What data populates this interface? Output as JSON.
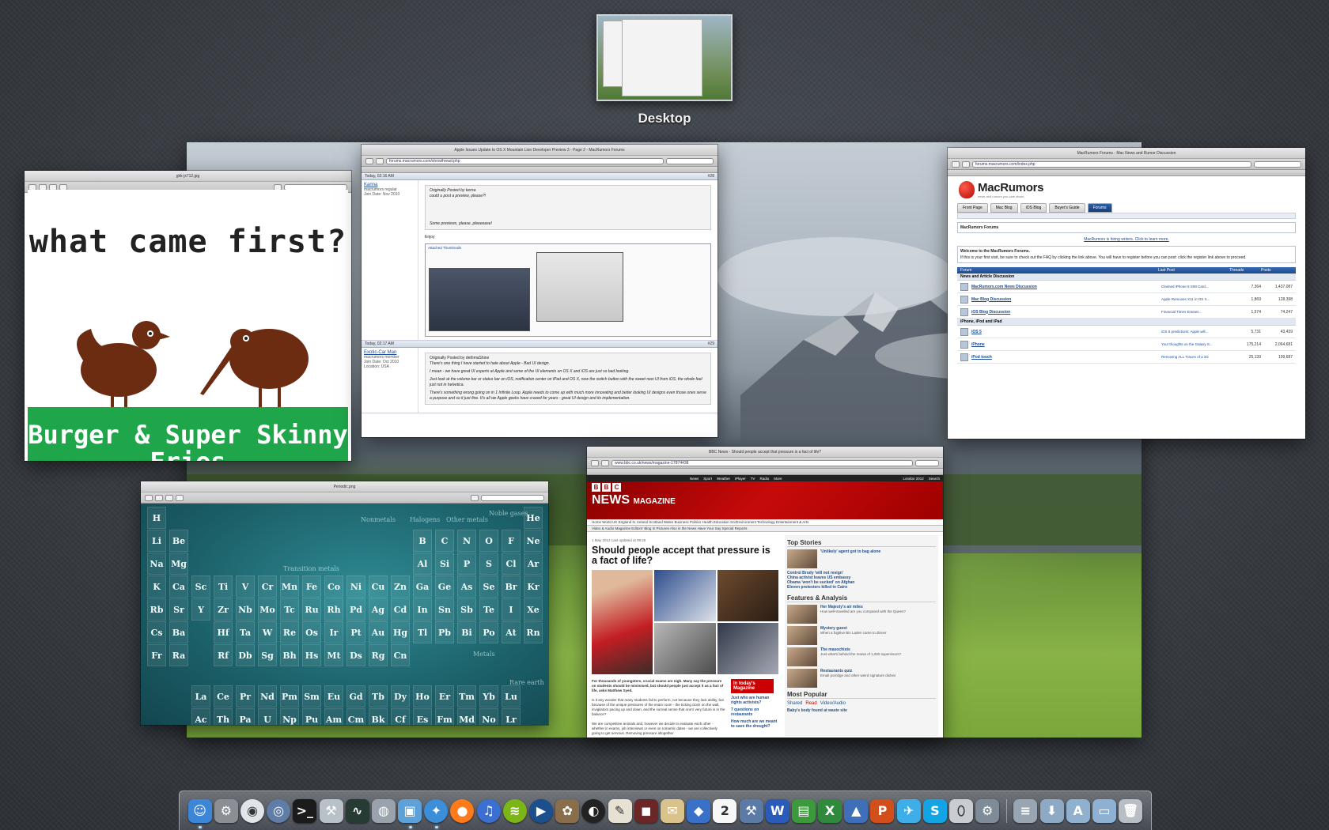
{
  "spaces": {
    "desktop_label": "Desktop"
  },
  "preview1": {
    "title": "gkk-jx712.jpg",
    "poster_title": "what came first?",
    "poster_band": "Burger & Super Skinny Fries"
  },
  "forum": {
    "title": "Apple Issues Update to OS X Mountain Lion Developer Preview 3 - Page 2 - MacRumors Forums",
    "url": "forums.macrumors.com/showthread.php",
    "post1": {
      "time": "Today, 02:16 AM",
      "num": "#28",
      "user": "Karina",
      "role": "macrumors regular",
      "join": "Join Date: Nov 2010",
      "quote_by": "Originally Posted by kerna",
      "quote_text": "could u post a preview, please?!",
      "quote_line2": "Some previews, please, pleeeease!",
      "enjoy": "Enjoy",
      "thumbs": "Attached Thumbnails"
    },
    "post2": {
      "time": "Today, 02:17 AM",
      "num": "#29",
      "user": "Exotic-Car Man",
      "role": "macrumors member",
      "join": "Join Date: Oct 2010",
      "location": "Location: USA",
      "quote_by": "Originally Posted by dethmaShine",
      "quote_text": "There's one thing I have started to hate about Apple - Bad UI design.",
      "line1": "I mean - we have great UI experts at Apple and some of the UI elements on OS X and iOS are just so bad looking.",
      "line2": "Just look at the volume bar or status bar on iOS, notification center on iPad and OS X, now the switch button with the sweet new UI from iOS, the whole feel just not in helvetica.",
      "line3": "There's something wrong going on in 1 Infinite Loop. Apple needs to come up with much more innovating and better looking UI designs even those ones serve a purpose and so it just fine. It's all we Apple geeks have craved for years - great UI design and its implementation."
    }
  },
  "macrumors": {
    "title": "MacRumors Forums - Mac News and Rumor Discussion",
    "url": "forums.macrumors.com/index.php",
    "logo": "MacRumors",
    "tagline": "news and rumors you care about",
    "nav": [
      "Front Page",
      "Mac Blog",
      "iOS Blog",
      "Buyer's Guide",
      "Forums"
    ],
    "forum_title": "MacRumors Forums",
    "link": "MacRumors is hiring writers. Click to learn more.",
    "welcome": "Welcome to the MacRumors Forums.",
    "welcome_text": "If this is your first visit, be sure to check out the FAQ by clicking the link above. You will have to register before you can post: click the register link above to proceed.",
    "col_forum": "Forum",
    "col_last": "Last Post",
    "col_threads": "Threads",
    "col_posts": "Posts",
    "cat1": "News and Article Discussion",
    "cat2": "iPhone, iPod and iPad",
    "rows": [
      {
        "name": "MacRumors.com News Discussion",
        "last": "Claimed iPhone 5 SIM Card...",
        "threads": "7,364",
        "posts": "1,437,087"
      },
      {
        "name": "Mac Blog Discussion",
        "last": "Apple Removes X11 in OS X...",
        "threads": "1,869",
        "posts": "128,398"
      },
      {
        "name": "iOS Blog Discussion",
        "last": "Financial Times Eraises...",
        "threads": "1,574",
        "posts": "74,247"
      },
      {
        "name": "iOS 5",
        "last": "iOS 5 predictions: Apple will...",
        "threads": "5,731",
        "posts": "43,439"
      },
      {
        "name": "iPhone",
        "last": "Your thoughts on the Galaxy S...",
        "threads": "175,214",
        "posts": "2,064,681"
      },
      {
        "name": "iPod touch",
        "last": "Removing ALL Traces of a 3G",
        "threads": "25,139",
        "posts": "199,687"
      }
    ]
  },
  "periodic": {
    "title": "Periodic.png",
    "nonmetals": "Nonmetals",
    "halogens": "Halogens",
    "noble": "Noble gases",
    "other_metals": "Other metals",
    "transition": "Transition metals",
    "metals": "Metals",
    "rare_earth": "Rare earth",
    "elements": [
      [
        "H",
        1,
        1
      ],
      [
        "He",
        1,
        18
      ],
      [
        "Li",
        2,
        1
      ],
      [
        "Be",
        2,
        2
      ],
      [
        "B",
        2,
        13
      ],
      [
        "C",
        2,
        14
      ],
      [
        "N",
        2,
        15
      ],
      [
        "O",
        2,
        16
      ],
      [
        "F",
        2,
        17
      ],
      [
        "Ne",
        2,
        18
      ],
      [
        "Na",
        3,
        1
      ],
      [
        "Mg",
        3,
        2
      ],
      [
        "Al",
        3,
        13
      ],
      [
        "Si",
        3,
        14
      ],
      [
        "P",
        3,
        15
      ],
      [
        "S",
        3,
        16
      ],
      [
        "Cl",
        3,
        17
      ],
      [
        "Ar",
        3,
        18
      ],
      [
        "K",
        4,
        1
      ],
      [
        "Ca",
        4,
        2
      ],
      [
        "Sc",
        4,
        3
      ],
      [
        "Ti",
        4,
        4
      ],
      [
        "V",
        4,
        5
      ],
      [
        "Cr",
        4,
        6
      ],
      [
        "Mn",
        4,
        7
      ],
      [
        "Fe",
        4,
        8
      ],
      [
        "Co",
        4,
        9
      ],
      [
        "Ni",
        4,
        10
      ],
      [
        "Cu",
        4,
        11
      ],
      [
        "Zn",
        4,
        12
      ],
      [
        "Ga",
        4,
        13
      ],
      [
        "Ge",
        4,
        14
      ],
      [
        "As",
        4,
        15
      ],
      [
        "Se",
        4,
        16
      ],
      [
        "Br",
        4,
        17
      ],
      [
        "Kr",
        4,
        18
      ],
      [
        "Rb",
        5,
        1
      ],
      [
        "Sr",
        5,
        2
      ],
      [
        "Y",
        5,
        3
      ],
      [
        "Zr",
        5,
        4
      ],
      [
        "Nb",
        5,
        5
      ],
      [
        "Mo",
        5,
        6
      ],
      [
        "Tc",
        5,
        7
      ],
      [
        "Ru",
        5,
        8
      ],
      [
        "Rh",
        5,
        9
      ],
      [
        "Pd",
        5,
        10
      ],
      [
        "Ag",
        5,
        11
      ],
      [
        "Cd",
        5,
        12
      ],
      [
        "In",
        5,
        13
      ],
      [
        "Sn",
        5,
        14
      ],
      [
        "Sb",
        5,
        15
      ],
      [
        "Te",
        5,
        16
      ],
      [
        "I",
        5,
        17
      ],
      [
        "Xe",
        5,
        18
      ],
      [
        "Cs",
        6,
        1
      ],
      [
        "Ba",
        6,
        2
      ],
      [
        "Hf",
        6,
        4
      ],
      [
        "Ta",
        6,
        5
      ],
      [
        "W",
        6,
        6
      ],
      [
        "Re",
        6,
        7
      ],
      [
        "Os",
        6,
        8
      ],
      [
        "Ir",
        6,
        9
      ],
      [
        "Pt",
        6,
        10
      ],
      [
        "Au",
        6,
        11
      ],
      [
        "Hg",
        6,
        12
      ],
      [
        "Tl",
        6,
        13
      ],
      [
        "Pb",
        6,
        14
      ],
      [
        "Bi",
        6,
        15
      ],
      [
        "Po",
        6,
        16
      ],
      [
        "At",
        6,
        17
      ],
      [
        "Rn",
        6,
        18
      ],
      [
        "Fr",
        7,
        1
      ],
      [
        "Ra",
        7,
        2
      ],
      [
        "Rf",
        7,
        4
      ],
      [
        "Db",
        7,
        5
      ],
      [
        "Sg",
        7,
        6
      ],
      [
        "Bh",
        7,
        7
      ],
      [
        "Hs",
        7,
        8
      ],
      [
        "Mt",
        7,
        9
      ],
      [
        "Ds",
        7,
        10
      ],
      [
        "Rg",
        7,
        11
      ],
      [
        "Cn",
        7,
        12
      ],
      [
        "La",
        9,
        3
      ],
      [
        "Ce",
        9,
        4
      ],
      [
        "Pr",
        9,
        5
      ],
      [
        "Nd",
        9,
        6
      ],
      [
        "Pm",
        9,
        7
      ],
      [
        "Sm",
        9,
        8
      ],
      [
        "Eu",
        9,
        9
      ],
      [
        "Gd",
        9,
        10
      ],
      [
        "Tb",
        9,
        11
      ],
      [
        "Dy",
        9,
        12
      ],
      [
        "Ho",
        9,
        13
      ],
      [
        "Er",
        9,
        14
      ],
      [
        "Tm",
        9,
        15
      ],
      [
        "Yb",
        9,
        16
      ],
      [
        "Lu",
        9,
        17
      ],
      [
        "Ac",
        10,
        3
      ],
      [
        "Th",
        10,
        4
      ],
      [
        "Pa",
        10,
        5
      ],
      [
        "U",
        10,
        6
      ],
      [
        "Np",
        10,
        7
      ],
      [
        "Pu",
        10,
        8
      ],
      [
        "Am",
        10,
        9
      ],
      [
        "Cm",
        10,
        10
      ],
      [
        "Bk",
        10,
        11
      ],
      [
        "Cf",
        10,
        12
      ],
      [
        "Es",
        10,
        13
      ],
      [
        "Fm",
        10,
        14
      ],
      [
        "Md",
        10,
        15
      ],
      [
        "No",
        10,
        16
      ],
      [
        "Lr",
        10,
        17
      ]
    ]
  },
  "bbc": {
    "title": "BBC News - Should people accept that pressure is a fact of life?",
    "url": "www.bbc.co.uk/news/magazine-17874438",
    "topbar": [
      "News",
      "Sport",
      "Weather",
      "iPlayer",
      "TV",
      "Radio",
      "More"
    ],
    "search": "Search",
    "london": "London 2012",
    "magazine": "NEWS",
    "magazine_sub": "MAGAZINE",
    "nav": "Home  World  UK  England  N. Ireland  Scotland  Wales  Business  Politics  Health  Education  Sci/Environment  Technology  Entertainment & Arts",
    "subnav": "Video & Audio  Magazine  Editors' Blog  In Pictures  Also in the News  Have Your Say  Special Reports",
    "date": "1 May 2012 Last updated at 09:25",
    "headline": "Should people accept that pressure is a fact of life?",
    "lede": "For thousands of youngsters, crucial exams are nigh. Many say the pressure on students should be minimised, but should people just accept it as a fact of life, asks Matthew Syed.",
    "body": "Is it any wonder that many students fail to perform, not because they lack ability, but because of the unique pressures of the exam room - the ticking clock on the wall, invigilators pacing up and down, and the surreal sense that one's very future is in the balance?",
    "body2": "We are competitive animals and, however we decide to evaluate each other - whether in exams, job interviews or even on romantic dates - we are collectively going to get nervous. Removing pressure altogether",
    "todays_mag": "In today's Magazine",
    "mag_links": [
      "Just who are human rights activists?",
      "7 questions on restaurants",
      "How much are we meant to save the drought?"
    ],
    "top_stories": "Top Stories",
    "top_items": [
      "'Unlikely' agent got to bag alone",
      "Control Brody 'will not resign'",
      "China activist leaves US embassy",
      "Obama 'won't be sucked' on Afghan",
      "Eleven protesters killed in Cairo"
    ],
    "features": "Features & Analysis",
    "feature_items": [
      {
        "title": "Her Majesty's air miles",
        "sub": "How well-travelled are you compared with the Queen?"
      },
      {
        "title": "Mystery guest",
        "sub": "When a fugitive Bin Laden came to dinner"
      },
      {
        "title": "The masochists",
        "sub": "Just what's behind the mania of 1,000 supervisors?"
      },
      {
        "title": "Restaurants quiz",
        "sub": "Email porridge and other weird signature dishes"
      }
    ],
    "most_popular": "Most Popular",
    "tabs": [
      "Shared",
      "Read",
      "Video/Audio"
    ],
    "popular_item": "Baby's body found at waste site"
  },
  "dock": {
    "items": [
      {
        "name": "finder",
        "glyph": "☺",
        "bg": "#3c86d8",
        "running": true
      },
      {
        "name": "system-preferences",
        "glyph": "⚙",
        "bg": "#8a8f96",
        "running": false
      },
      {
        "name": "airport-utility",
        "glyph": "◉",
        "bg": "#dfe5ea",
        "running": false
      },
      {
        "name": "network-utility",
        "glyph": "◎",
        "bg": "#5f7da6",
        "running": false
      },
      {
        "name": "terminal",
        "glyph": ">_",
        "bg": "#1b1b1b",
        "running": false
      },
      {
        "name": "instruments",
        "glyph": "⚒",
        "bg": "#b8c0c8",
        "running": false
      },
      {
        "name": "activity-monitor",
        "glyph": "∿",
        "bg": "#263b33",
        "running": false
      },
      {
        "name": "disk-utility",
        "glyph": "◍",
        "bg": "#9aa2ab",
        "running": false
      },
      {
        "name": "preview",
        "glyph": "▣",
        "bg": "#5da1d8",
        "running": true
      },
      {
        "name": "safari",
        "glyph": "✦",
        "bg": "#3d8ed8",
        "running": true
      },
      {
        "name": "firefox",
        "glyph": "●",
        "bg": "#ff7a1a",
        "running": false
      },
      {
        "name": "itunes",
        "glyph": "♫",
        "bg": "#3c6fd2",
        "running": false
      },
      {
        "name": "spotify",
        "glyph": "≋",
        "bg": "#7cb518",
        "running": false
      },
      {
        "name": "quicktime",
        "glyph": "▶",
        "bg": "#1c4f8d",
        "running": false
      },
      {
        "name": "iphoto",
        "glyph": "✿",
        "bg": "#8a6d4a",
        "running": false
      },
      {
        "name": "aperture",
        "glyph": "◐",
        "bg": "#222",
        "running": false
      },
      {
        "name": "textedit",
        "glyph": "✎",
        "bg": "#e7e1d3",
        "running": false
      },
      {
        "name": "photo-booth",
        "glyph": "◼",
        "bg": "#6b2727",
        "running": false
      },
      {
        "name": "mail",
        "glyph": "✉",
        "bg": "#d9c38a",
        "running": false
      },
      {
        "name": "skitch",
        "glyph": "◆",
        "bg": "#3a71c8",
        "running": false
      },
      {
        "name": "calendar",
        "glyph": "2",
        "bg": "#f7f7f7",
        "running": false
      },
      {
        "name": "xcode",
        "glyph": "⚒",
        "bg": "#5b7aa5",
        "running": false
      },
      {
        "name": "word",
        "glyph": "W",
        "bg": "#2a5bb8",
        "running": false
      },
      {
        "name": "numbers",
        "glyph": "▤",
        "bg": "#3c9a3c",
        "running": false
      },
      {
        "name": "excel",
        "glyph": "X",
        "bg": "#2f8a3c",
        "running": false
      },
      {
        "name": "keynote",
        "glyph": "▲",
        "bg": "#3e6fb8",
        "running": false
      },
      {
        "name": "powerpoint",
        "glyph": "P",
        "bg": "#d24f1b",
        "running": false
      },
      {
        "name": "twitter",
        "glyph": "✈",
        "bg": "#3eaee9",
        "running": false
      },
      {
        "name": "skype",
        "glyph": "S",
        "bg": "#12a4e5",
        "running": false
      },
      {
        "name": "mouse",
        "glyph": "⬯",
        "bg": "#c9cdd2",
        "running": false
      },
      {
        "name": "automator",
        "glyph": "⚙",
        "bg": "#7e8b98",
        "running": false
      },
      {
        "name": "documents",
        "glyph": "≡",
        "bg": "#98a6b4",
        "running": false
      },
      {
        "name": "downloads",
        "glyph": "⬇",
        "bg": "#8da9c4",
        "running": false
      },
      {
        "name": "applications",
        "glyph": "A",
        "bg": "#8fb0cf",
        "running": false
      },
      {
        "name": "folder",
        "glyph": "▭",
        "bg": "#8db0d3",
        "running": false
      },
      {
        "name": "trash",
        "glyph": "🗑",
        "bg": "#b9bec4",
        "running": false
      }
    ]
  }
}
